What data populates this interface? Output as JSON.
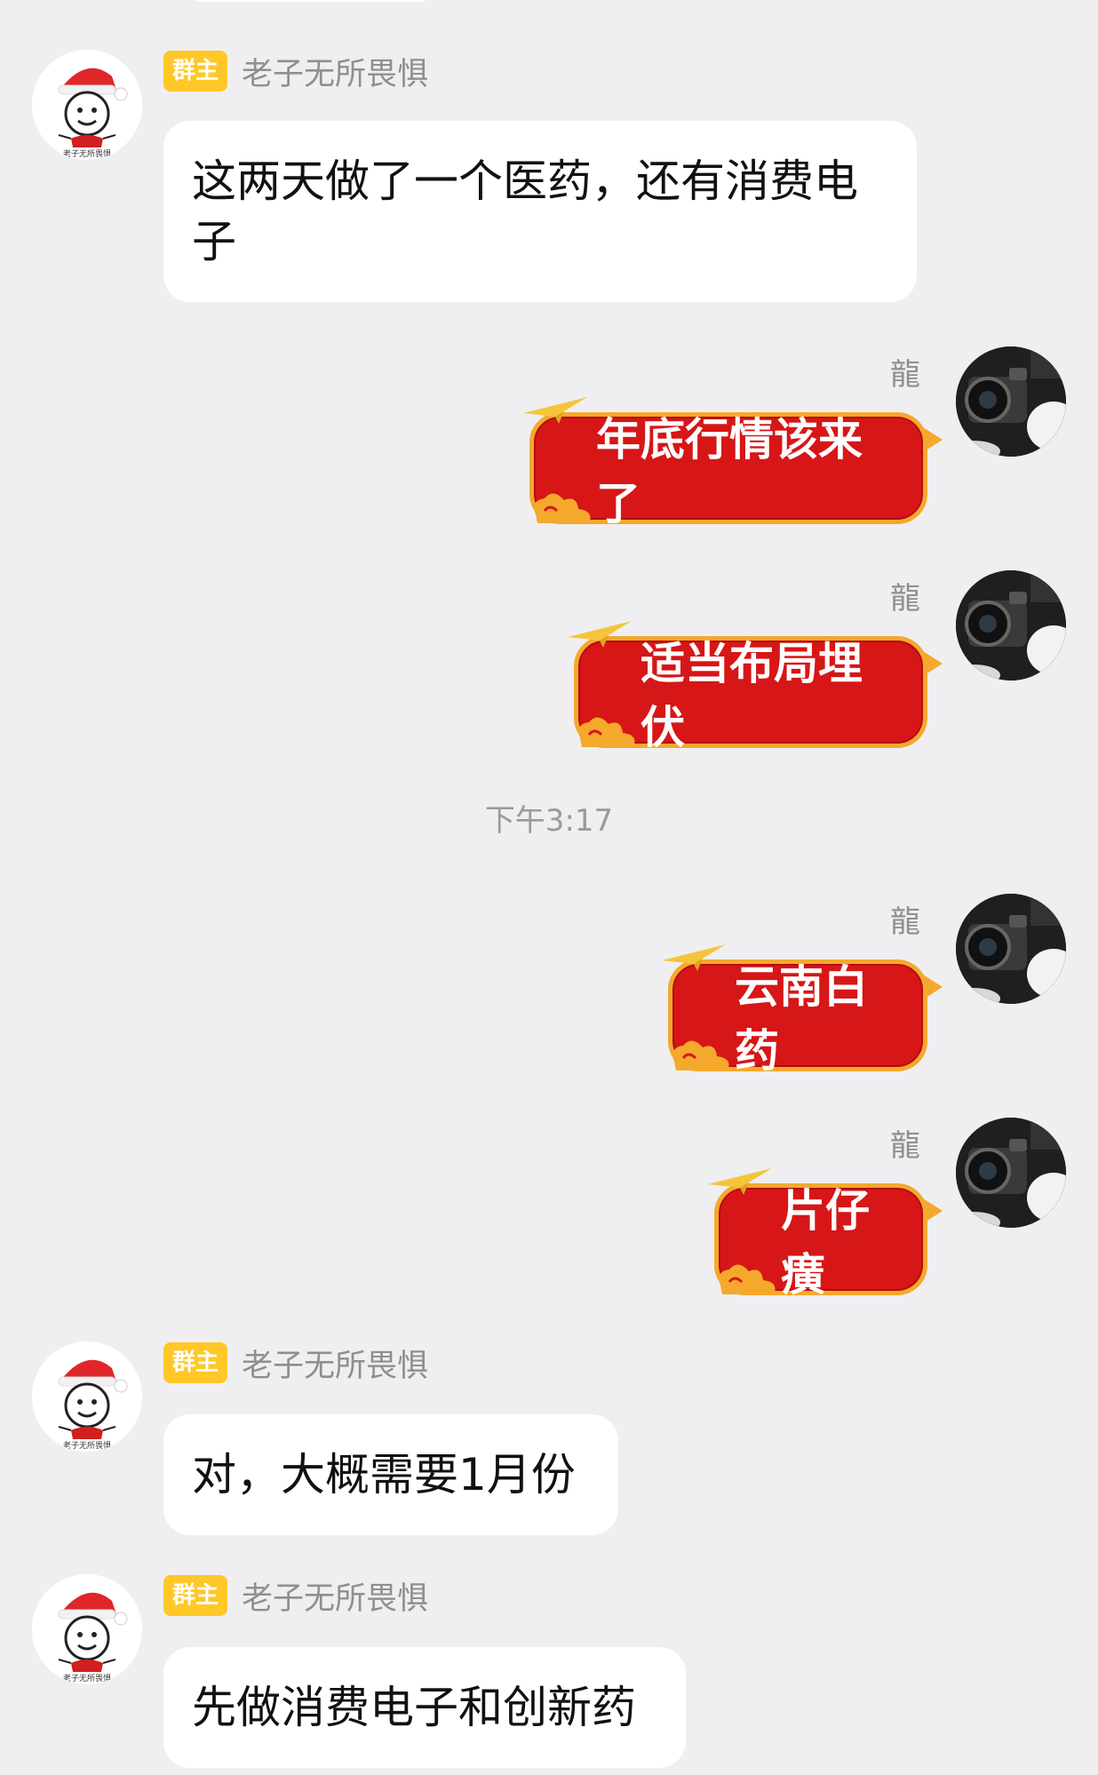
{
  "owner": {
    "badge": "群主",
    "name": "老子无所畏惧",
    "avatar_caption": "老子无所畏惧"
  },
  "me": {
    "name": "龍"
  },
  "timestamp": "下午3:17",
  "messages": [
    {
      "side": "left",
      "text": "这两天做了一个医药，还有消费电子"
    },
    {
      "side": "right",
      "text": "年底行情该来了"
    },
    {
      "side": "right",
      "text": "适当布局埋伏"
    },
    {
      "side": "right",
      "text": "云南白药"
    },
    {
      "side": "right",
      "text": "片仔癀"
    },
    {
      "side": "left",
      "text": "对，大概需要1月份"
    },
    {
      "side": "left",
      "text": "先做消费电子和创新药"
    }
  ],
  "colors": {
    "background": "#efeff2",
    "badge": "#ffc727",
    "festive_bubble": "#d71617",
    "festive_border": "#f4a92c"
  }
}
